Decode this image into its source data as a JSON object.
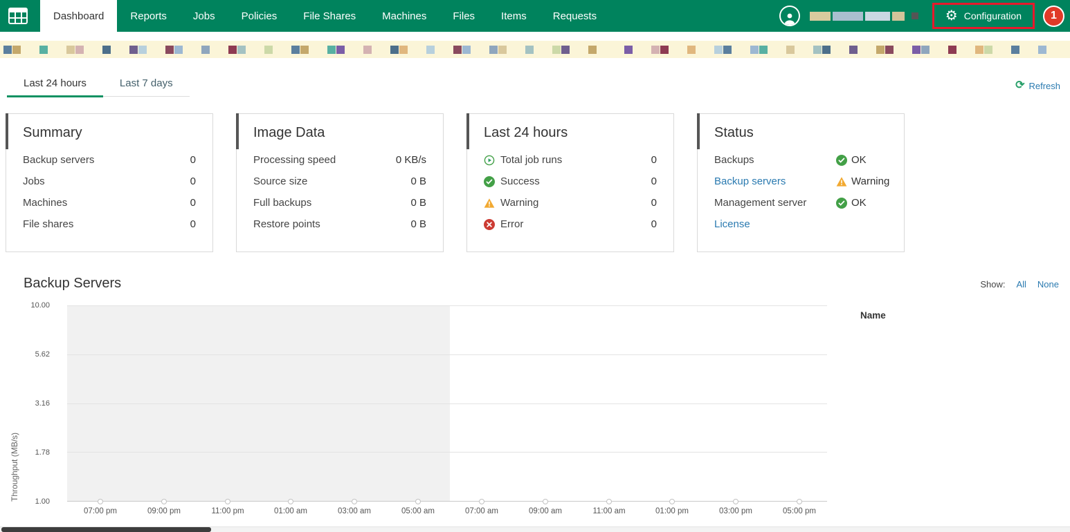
{
  "icons": {
    "gear": "⚙",
    "refresh": "⟳"
  },
  "topbar": {
    "nav": [
      {
        "label": "Dashboard"
      },
      {
        "label": "Reports"
      },
      {
        "label": "Jobs"
      },
      {
        "label": "Policies"
      },
      {
        "label": "File Shares"
      },
      {
        "label": "Machines"
      },
      {
        "label": "Files"
      },
      {
        "label": "Items"
      },
      {
        "label": "Requests"
      }
    ],
    "configuration_label": "Configuration",
    "notification_count": "1"
  },
  "filter_tabs": {
    "last24": "Last 24 hours",
    "last7": "Last 7 days",
    "refresh_label": "Refresh"
  },
  "cards": {
    "summary": {
      "title": "Summary",
      "rows": [
        {
          "label": "Backup servers",
          "value": "0"
        },
        {
          "label": "Jobs",
          "value": "0"
        },
        {
          "label": "Machines",
          "value": "0"
        },
        {
          "label": "File shares",
          "value": "0"
        }
      ]
    },
    "image_data": {
      "title": "Image Data",
      "rows": [
        {
          "label": "Processing speed",
          "value": "0 KB/s"
        },
        {
          "label": "Source size",
          "value": "0 B"
        },
        {
          "label": "Full backups",
          "value": "0 B"
        },
        {
          "label": "Restore points",
          "value": "0 B"
        }
      ]
    },
    "last24": {
      "title": "Last 24 hours",
      "rows": [
        {
          "icon": "play",
          "label": "Total job runs",
          "value": "0"
        },
        {
          "icon": "success",
          "label": "Success",
          "value": "0"
        },
        {
          "icon": "warning",
          "label": "Warning",
          "value": "0"
        },
        {
          "icon": "error",
          "label": "Error",
          "value": "0"
        }
      ]
    },
    "status": {
      "title": "Status",
      "rows": [
        {
          "label": "Backups",
          "link": false,
          "icon": "success",
          "status": "OK"
        },
        {
          "label": "Backup servers",
          "link": true,
          "icon": "warning",
          "status": "Warning"
        },
        {
          "label": "Management server",
          "link": false,
          "icon": "success",
          "status": "OK"
        },
        {
          "label": "License",
          "link": true,
          "icon": "",
          "status": ""
        }
      ]
    }
  },
  "backup_servers_section": {
    "title": "Backup Servers",
    "show_label": "Show:",
    "all_label": "All",
    "none_label": "None",
    "legend_name": "Name"
  },
  "chart_data": {
    "type": "line",
    "title": "Backup Servers",
    "ylabel": "Throughput (MB/s)",
    "yscale": "log",
    "ylim": [
      1.0,
      10.0
    ],
    "yticks": [
      "10.00",
      "5.62",
      "3.16",
      "1.78",
      "1.00"
    ],
    "xticks": [
      "07:00 pm",
      "09:00 pm",
      "11:00 pm",
      "01:00 am",
      "03:00 am",
      "05:00 am",
      "07:00 am",
      "09:00 am",
      "11:00 am",
      "01:00 pm",
      "03:00 pm",
      "05:00 pm"
    ],
    "series": [],
    "shaded_region_end_fraction": 0.504,
    "grid": true,
    "legend_position": "right"
  },
  "colors": {
    "brand_green": "#00835d",
    "active_underline_green": "#0f9162",
    "link_blue": "#2a7ab0",
    "success_green": "#43a047",
    "warning_yellow": "#f2a931",
    "error_red": "#cc3b33",
    "badge_red": "#e03a28",
    "annotation_red": "#e8192c",
    "mosaic_bg": "#fbf5d8",
    "chart_shade": "#f1f1f1"
  },
  "mosaic_palette": [
    "#d9c89c",
    "#8fa6bd",
    "#7b5ea7",
    "#58b0a2",
    "#9db8d2",
    "#8a4a5e",
    "#c4a86b",
    "#5b7f9e",
    "#b7d0dd",
    "#6f5f8e",
    "#ccd9a8",
    "#e0b77e",
    "#4d6f8a",
    "#a4c2c2",
    "#8e3b52",
    "#d4b2b2"
  ]
}
